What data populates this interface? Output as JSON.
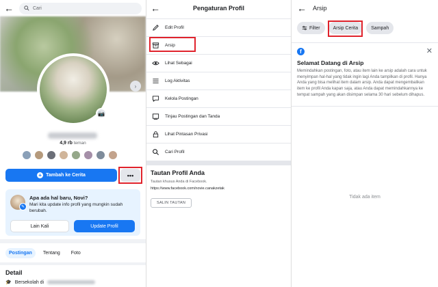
{
  "profile_panel": {
    "search_placeholder": "Cari",
    "friends_count": "4,9 rb",
    "friends_suffix": "teman",
    "add_story_label": "Tambah ke Cerita",
    "more_label": "•••",
    "info_card": {
      "title": "Apa ada hal baru, Novi?",
      "text": "Mari kita update info profil yang mungkin sudah berubah.",
      "later_label": "Lain Kali",
      "update_label": "Update Profil"
    },
    "tabs": [
      "Postingan",
      "Tentang",
      "Foto"
    ],
    "detail_title": "Detail",
    "detail_row_prefix": "Bersekolah di"
  },
  "settings_panel": {
    "title": "Pengaturan Profil",
    "menu": [
      {
        "label": "Edit Profil",
        "icon": "pencil-icon"
      },
      {
        "label": "Arsip",
        "icon": "archive-icon"
      },
      {
        "label": "Lihat Sebagai",
        "icon": "eye-icon"
      },
      {
        "label": "Log Aktivitas",
        "icon": "list-icon"
      },
      {
        "label": "Kelola Postingan",
        "icon": "chat-icon"
      },
      {
        "label": "Tinjau Postingan dan Tanda",
        "icon": "tag-icon"
      },
      {
        "label": "Lihat Pintasan Privasi",
        "icon": "lock-icon"
      },
      {
        "label": "Cari Profil",
        "icon": "search-icon"
      }
    ],
    "url_section": {
      "title": "Tautan Profil Anda",
      "subtitle": "Tautan khusus Anda di Facebook.",
      "url": "https://www.facebook.com/novie.canakzetak",
      "copy_label": "SALIN TAUTAN"
    }
  },
  "archive_panel": {
    "title": "Arsip",
    "chips": [
      "Filter",
      "Arsip Cerita",
      "Sampah"
    ],
    "welcome": {
      "title": "Selamat Datang di Arsip",
      "text": "Memindahkan postingan, foto, atau item lain ke arsip adalah cara untuk menyimpan hal-hal yang tidak ingin lagi Anda tampilkan di profil. Hanya Anda yang bisa melihat item dalam arsip. Anda dapat mengembalikan item ke profil Anda kapan saja, atau Anda dapat memindahkannya ke tempat sampah yang akan disimpan selama 30 hari sebelum dihapus."
    },
    "empty_text": "Tidak ada item"
  },
  "colors": {
    "accent": "#1877f2",
    "highlight": "#e0222b"
  }
}
